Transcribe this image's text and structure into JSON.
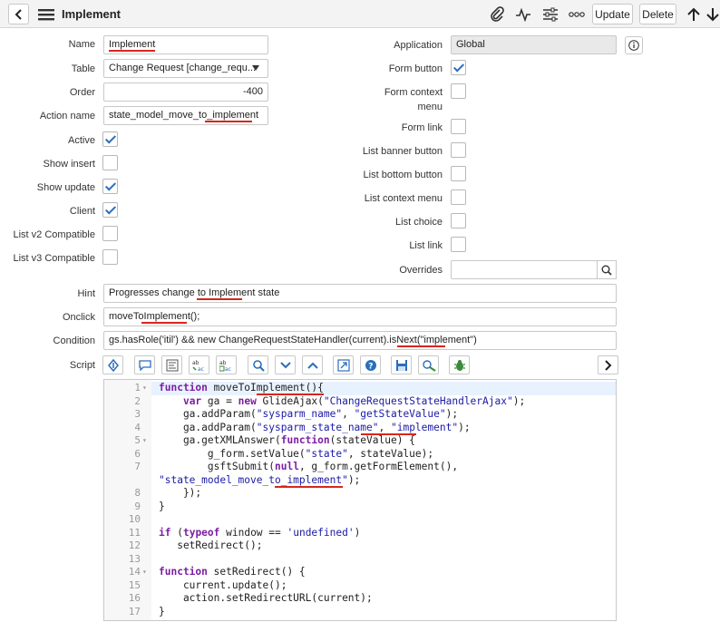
{
  "header": {
    "title": "Implement",
    "update_label": "Update",
    "delete_label": "Delete"
  },
  "form": {
    "name_label": "Name",
    "name_value": "Implement",
    "table_label": "Table",
    "table_value": "Change Request [change_requ...",
    "order_label": "Order",
    "order_value": "-400",
    "action_name_label": "Action name",
    "action_name_value": "state_model_move_to_implement",
    "active_label": "Active",
    "active": true,
    "show_insert_label": "Show insert",
    "show_insert": false,
    "show_update_label": "Show update",
    "show_update": true,
    "client_label": "Client",
    "client": true,
    "list_v2_label": "List v2 Compatible",
    "list_v2": false,
    "list_v3_label": "List v3 Compatible",
    "list_v3": false,
    "application_label": "Application",
    "application_value": "Global",
    "form_button_label": "Form button",
    "form_button": true,
    "form_context_menu_label_1": "Form context",
    "form_context_menu_label_2": "menu",
    "form_context_menu": false,
    "form_link_label": "Form link",
    "form_link": false,
    "list_banner_button_label": "List banner button",
    "list_banner_button": false,
    "list_bottom_button_label": "List bottom button",
    "list_bottom_button": false,
    "list_context_menu_label": "List context menu",
    "list_context_menu": false,
    "list_choice_label": "List choice",
    "list_choice": false,
    "list_link_label": "List link",
    "list_link": false,
    "overrides_label": "Overrides",
    "overrides_value": "",
    "hint_label": "Hint",
    "hint_value": "Progresses change to Implement state",
    "onclick_label": "Onclick",
    "onclick_value": "moveToImplement();",
    "condition_label": "Condition",
    "condition_value": "gs.hasRole('itil') && new ChangeRequestStateHandler(current).isNext(\"implement\")",
    "script_label": "Script"
  },
  "script": {
    "line_numbers": [
      "1",
      "2",
      "3",
      "4",
      "5",
      "6",
      "7",
      "",
      "8",
      "9",
      "10",
      "11",
      "12",
      "13",
      "14",
      "15",
      "16",
      "17"
    ],
    "lines": [
      "function moveToImplement(){",
      "    var ga = new GlideAjax(\"ChangeRequestStateHandlerAjax\");",
      "    ga.addParam(\"sysparm_name\", \"getStateValue\");",
      "    ga.addParam(\"sysparm_state_name\", \"implement\");",
      "    ga.getXMLAnswer(function(stateValue) {",
      "        g_form.setValue(\"state\", stateValue);",
      "        gsftSubmit(null, g_form.getFormElement(),",
      "\"state_model_move_to_implement\");",
      "    });",
      "}",
      "",
      "if (typeof window == 'undefined')",
      "   setRedirect();",
      "",
      "function setRedirect() {",
      "    current.update();",
      "    action.setRedirectURL(current);",
      "}"
    ]
  },
  "icons": [
    "back-icon",
    "menu-icon",
    "attachment-icon",
    "activity-icon",
    "settings-icon",
    "more-icon",
    "arrow-up-icon",
    "arrow-down-icon",
    "info-icon",
    "search-icon",
    "dropdown-icon"
  ]
}
